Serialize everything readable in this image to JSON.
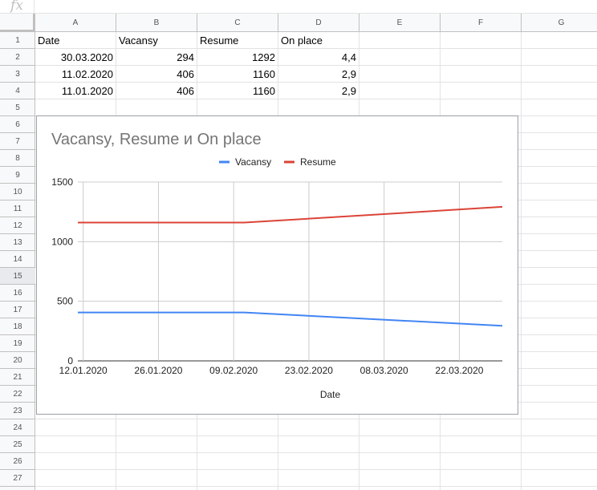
{
  "formula_bar": {
    "fx_label": "fx"
  },
  "columns": [
    "A",
    "B",
    "C",
    "D",
    "E",
    "F",
    "G"
  ],
  "rows": [
    "1",
    "2",
    "3",
    "4",
    "5",
    "6",
    "7",
    "8",
    "9",
    "10",
    "11",
    "12",
    "13",
    "14",
    "15",
    "16",
    "17",
    "18",
    "19",
    "20",
    "21",
    "22",
    "23",
    "24",
    "25",
    "26",
    "27"
  ],
  "selected_row": "15",
  "sheet": {
    "headers": [
      "Date",
      "Vacansy",
      "Resume",
      "On place"
    ],
    "data": [
      [
        "30.03.2020",
        "294",
        "1292",
        "4,4"
      ],
      [
        "11.02.2020",
        "406",
        "1160",
        "2,9"
      ],
      [
        "11.01.2020",
        "406",
        "1160",
        "2,9"
      ]
    ]
  },
  "chart_data": {
    "type": "line",
    "title": "Vacansy, Resume и On place",
    "xlabel": "Date",
    "ylabel": "",
    "x": [
      "11.01.2020",
      "11.02.2020",
      "30.03.2020"
    ],
    "x_days": [
      0,
      31,
      79
    ],
    "xticks": [
      "12.01.2020",
      "26.01.2020",
      "09.02.2020",
      "23.02.2020",
      "08.03.2020",
      "22.03.2020"
    ],
    "xticks_days": [
      1,
      15,
      29,
      43,
      57,
      71
    ],
    "ylim": [
      0,
      1500
    ],
    "yticks": [
      "0",
      "500",
      "1000",
      "1500"
    ],
    "yticks_values": [
      0,
      500,
      1000,
      1500
    ],
    "legend_position": "top",
    "grid": true,
    "series": [
      {
        "name": "Vacansy",
        "values": [
          406,
          406,
          294
        ],
        "color": "#4285f4"
      },
      {
        "name": "Resume",
        "values": [
          1160,
          1160,
          1292
        ],
        "color": "#db4437"
      }
    ]
  }
}
